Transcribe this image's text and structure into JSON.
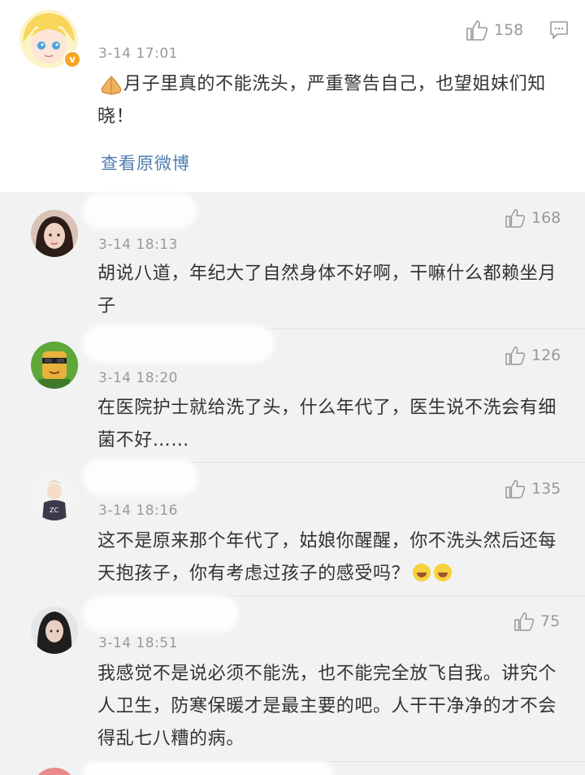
{
  "main_post": {
    "time": "3-14 17:01",
    "text": "月子里真的不能洗头，严重警告自己，也望姐妹们知晓！",
    "text_icon": "praying-hands-icon",
    "likes": "158",
    "view_original": "查看原微博"
  },
  "comments": [
    {
      "time": "3-14 18:13",
      "text": "胡说八道，年纪大了自然身体不好啊，干嘛什么都赖坐月子",
      "likes": "168"
    },
    {
      "time": "3-14 18:20",
      "text": "在医院护士就给洗了头，什么年代了，医生说不洗会有细菌不好……",
      "likes": "126"
    },
    {
      "time": "3-14 18:16",
      "text": "这不是原来那个年代了，姑娘你醒醒，你不洗头然后还每天抱孩子，你有考虑过孩子的感受吗？",
      "likes": "135",
      "emojis": [
        "laughing-crying-icon",
        "laughing-crying-icon"
      ]
    },
    {
      "time": "3-14 18:51",
      "text": "我感觉不是说必须不能洗，也不能完全放飞自我。讲究个人卫生，防寒保暖才是最主要的吧。人干干净净的才不会得乱七八糟的病。",
      "likes": "75"
    }
  ],
  "colors": {
    "link": "#507daf",
    "time": "#9a9a9a",
    "text": "#333333",
    "reply_background": "#f2f2f2",
    "verified_badge": "#f5a623"
  }
}
